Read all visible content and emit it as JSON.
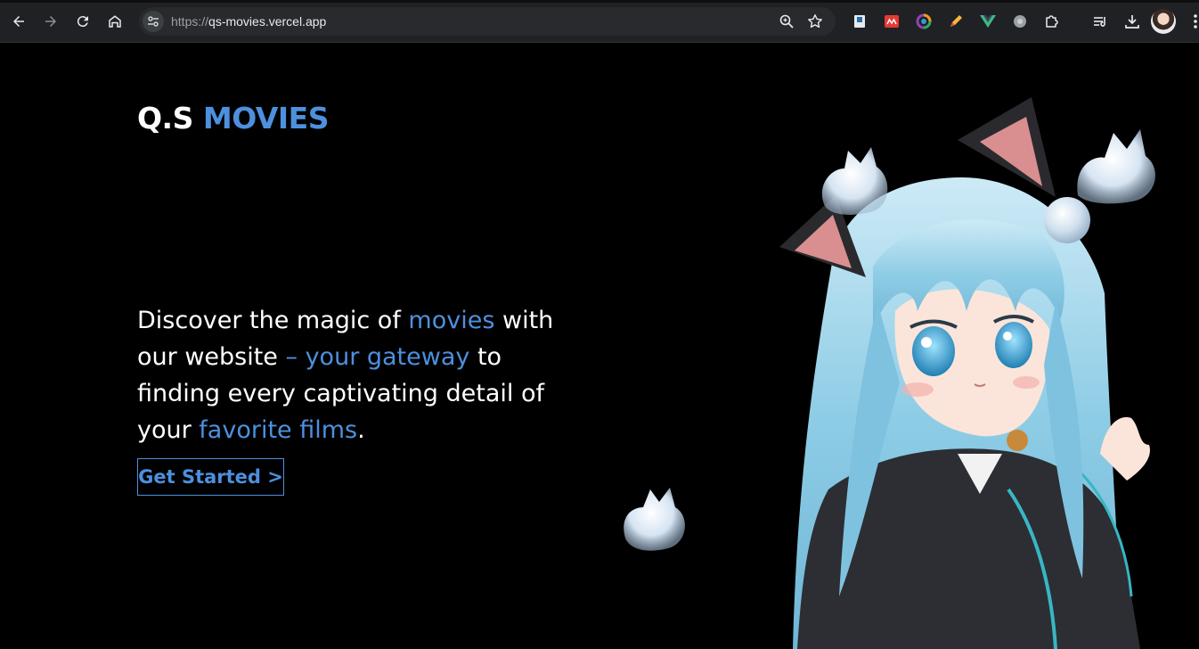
{
  "browser": {
    "url_scheme": "https://",
    "url_host": "qs-movies.vercel.app"
  },
  "page": {
    "logo": {
      "prefix": "Q.S",
      "accent": "MOVIES"
    },
    "hero": {
      "parts": [
        "Discover the magic of ",
        "movies",
        " with our website ",
        "– your gateway",
        " to finding every captivating detail of your ",
        "favorite films",
        "."
      ]
    },
    "cta_label": "Get Started >"
  },
  "colors": {
    "accent": "#4d90de",
    "background": "#000000",
    "chrome": "#202124"
  }
}
